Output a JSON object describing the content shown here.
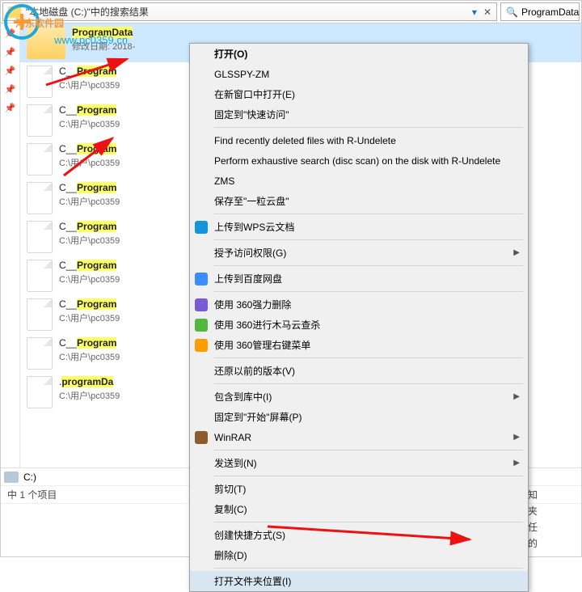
{
  "addressbar": {
    "crumb": "\"本地磁盘 (C:)\"中的搜索结果",
    "search_value": "ProgramData"
  },
  "watermark": {
    "title": "河东软件园",
    "url": "www.pc0359.cn"
  },
  "items": [
    {
      "name_pre": "",
      "name_hl": "ProgramData",
      "name_post": "",
      "sub": "修改日期: 2018-",
      "type": "folder",
      "selected": true
    },
    {
      "name_pre": "C__",
      "name_hl": "Program",
      "name_post": "",
      "sub": "C:\\用户\\pc0359",
      "type": "file"
    },
    {
      "name_pre": "C__",
      "name_hl": "Program",
      "name_post": "",
      "sub": "C:\\用户\\pc0359",
      "type": "file"
    },
    {
      "name_pre": "C__",
      "name_hl": "Program",
      "name_post": "",
      "sub": "C:\\用户\\pc0359",
      "type": "file"
    },
    {
      "name_pre": "C__",
      "name_hl": "Program",
      "name_post": "",
      "sub": "C:\\用户\\pc0359",
      "type": "file"
    },
    {
      "name_pre": "C__",
      "name_hl": "Program",
      "name_post": "",
      "sub": "C:\\用户\\pc0359",
      "type": "file"
    },
    {
      "name_pre": "C__",
      "name_hl": "Program",
      "name_post": "",
      "sub": "C:\\用户\\pc0359",
      "type": "file"
    },
    {
      "name_pre": "C__",
      "name_hl": "Program",
      "name_post": "",
      "sub": "C:\\用户\\pc0359",
      "type": "file"
    },
    {
      "name_pre": "C__",
      "name_hl": "Program",
      "name_post": "",
      "sub": "C:\\用户\\pc0359",
      "type": "file"
    },
    {
      "name_pre": ".",
      "name_hl": "programDa",
      "name_post": "",
      "sub": "C:\\用户\\pc0359",
      "type": "file"
    }
  ],
  "menu": [
    {
      "label": "打开(O)",
      "bold": true
    },
    {
      "label": "GLSSPY-ZM"
    },
    {
      "label": "在新窗口中打开(E)"
    },
    {
      "label": "固定到\"快速访问\""
    },
    {
      "sep": true
    },
    {
      "label": "Find recently deleted files with R-Undelete"
    },
    {
      "label": "Perform exhaustive search (disc scan) on the disk with R-Undelete"
    },
    {
      "label": "ZMS"
    },
    {
      "label": "保存至\"一粒云盘\""
    },
    {
      "sep": true
    },
    {
      "label": "上传到WPS云文档",
      "icon": "wps",
      "icon_color": "#1296db"
    },
    {
      "sep": true
    },
    {
      "label": "授予访问权限(G)",
      "arrow": true
    },
    {
      "sep": true
    },
    {
      "label": "上传到百度网盘",
      "icon": "cloud",
      "icon_color": "#3b8cff"
    },
    {
      "sep": true
    },
    {
      "label": "使用 360强力删除",
      "icon": "del",
      "icon_color": "#7a5bd6"
    },
    {
      "label": "使用 360进行木马云查杀",
      "icon": "scan",
      "icon_color": "#50b840"
    },
    {
      "label": "使用 360管理右键菜单",
      "icon": "mgr",
      "icon_color": "#ff9c00"
    },
    {
      "sep": true
    },
    {
      "label": "还原以前的版本(V)"
    },
    {
      "sep": true
    },
    {
      "label": "包含到库中(I)",
      "arrow": true
    },
    {
      "label": "固定到\"开始\"屏幕(P)"
    },
    {
      "label": "WinRAR",
      "icon": "rar",
      "icon_color": "#8a5c2e",
      "arrow": true
    },
    {
      "sep": true
    },
    {
      "label": "发送到(N)",
      "arrow": true
    },
    {
      "sep": true
    },
    {
      "label": "剪切(T)"
    },
    {
      "label": "复制(C)"
    },
    {
      "sep": true
    },
    {
      "label": "创建快捷方式(S)"
    },
    {
      "label": "删除(D)"
    },
    {
      "sep": true
    },
    {
      "label": "打开文件夹位置(I)",
      "hovered": true
    }
  ],
  "drive": {
    "label": "C:)"
  },
  "status": {
    "text": "中 1 个项目"
  },
  "sidetext": [
    "知",
    "夹",
    "任",
    "的"
  ]
}
